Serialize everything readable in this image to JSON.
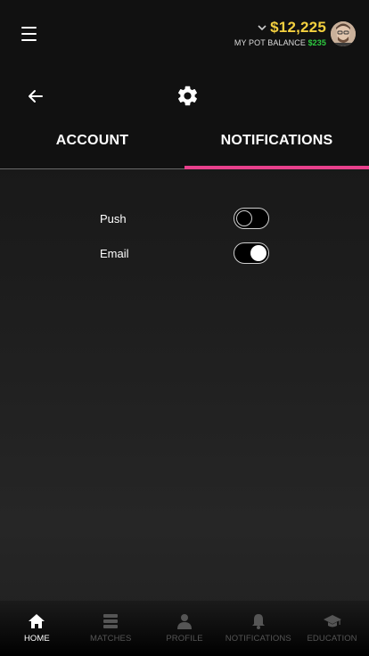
{
  "topbar": {
    "balance": "$12,225",
    "pot_label": "MY POT BALANCE",
    "pot_amount": "$235"
  },
  "header": {
    "back_icon": "arrow-left-icon",
    "settings_icon": "gear-icon"
  },
  "tabs": [
    {
      "label": "ACCOUNT",
      "active": false
    },
    {
      "label": "NOTIFICATIONS",
      "active": true
    }
  ],
  "settings": [
    {
      "label": "Push",
      "enabled": false
    },
    {
      "label": "Email",
      "enabled": true
    }
  ],
  "bottom_nav": [
    {
      "label": "HOME",
      "icon": "home-icon",
      "active": true
    },
    {
      "label": "MATCHES",
      "icon": "matches-icon",
      "active": false
    },
    {
      "label": "PROFILE",
      "icon": "profile-icon",
      "active": false
    },
    {
      "label": "NOTIFICATIONS",
      "icon": "bell-icon",
      "active": false
    },
    {
      "label": "EDUCATION",
      "icon": "graduation-cap-icon",
      "active": false
    }
  ],
  "colors": {
    "accent": "#e8408c",
    "balance": "#f4d03f",
    "pot": "#2ecc40"
  }
}
